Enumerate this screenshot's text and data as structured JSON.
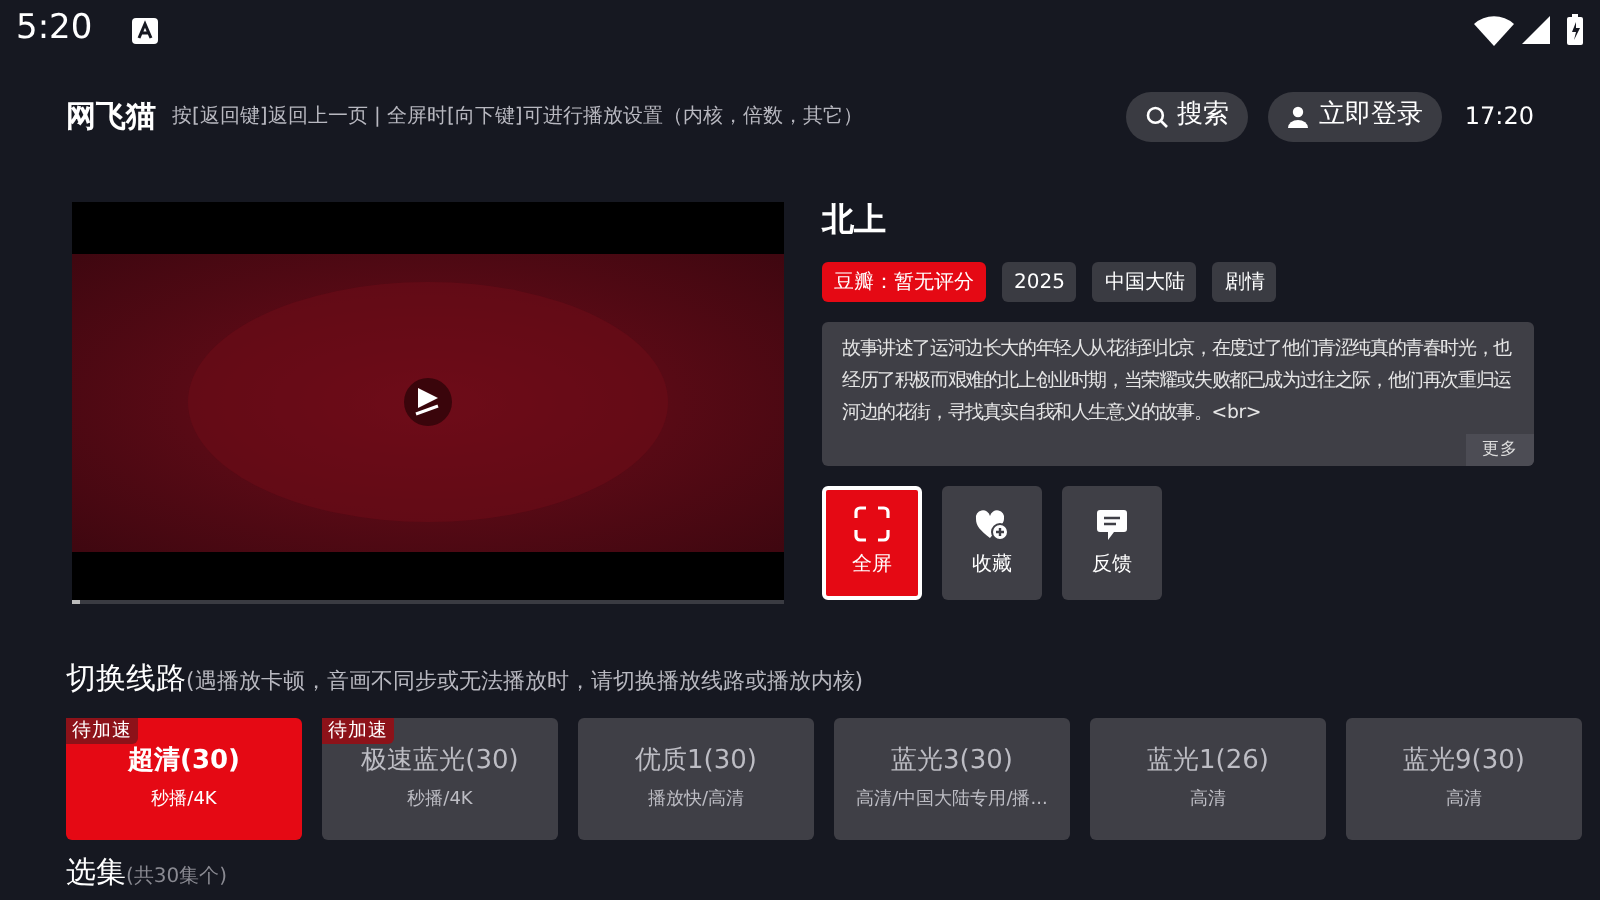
{
  "status_bar": {
    "time": "5:20"
  },
  "header": {
    "app_name": "网飞猫",
    "hint": "按[返回键]返回上一页 | 全屏时[向下键]可进行播放设置（内核，倍数，其它）",
    "search": "搜索",
    "login": "立即登录",
    "clock": "17:20"
  },
  "player": {
    "progress": {
      "level": 0.01
    }
  },
  "movie": {
    "title": "北上",
    "tags": [
      {
        "label": "豆瓣：暂无评分",
        "kind": "rating"
      },
      {
        "label": "2025",
        "kind": "plain"
      },
      {
        "label": "中国大陆",
        "kind": "plain"
      },
      {
        "label": "剧情",
        "kind": "plain"
      }
    ],
    "description": "故事讲述了运河边长大的年轻人从花街到北京，在度过了他们青涩纯真的青春时光，也经历了积极而艰难的北上创业时期，当荣耀或失败都已成为过往之际，他们再次重归运河边的花街，寻找真实自我和人生意义的故事。<br>",
    "more": "更多"
  },
  "actions": [
    {
      "label": "全屏",
      "kind": "fullscreen",
      "selected": true
    },
    {
      "label": "收藏",
      "kind": "favorite",
      "selected": false
    },
    {
      "label": "反馈",
      "kind": "feedback",
      "selected": false
    }
  ],
  "routes": {
    "title": "切换线路",
    "note": "(遇播放卡顿，音画不同步或无法播放时，请切换播放线路或播放内核)",
    "items": [
      {
        "name": "超清(30)",
        "sub": "秒播/4K",
        "badge": "待加速",
        "selected": true
      },
      {
        "name": "极速蓝光(30)",
        "sub": "秒播/4K",
        "badge": "待加速",
        "selected": false
      },
      {
        "name": "优质1(30)",
        "sub": "播放快/高清",
        "selected": false
      },
      {
        "name": "蓝光3(30)",
        "sub": "高清/中国大陆专用/播...",
        "selected": false
      },
      {
        "name": "蓝光1(26)",
        "sub": "高清",
        "selected": false
      },
      {
        "name": "蓝光9(30)",
        "sub": "高清",
        "selected": false
      }
    ]
  },
  "episodes": {
    "title": "选集",
    "note": "(共30集个)"
  }
}
